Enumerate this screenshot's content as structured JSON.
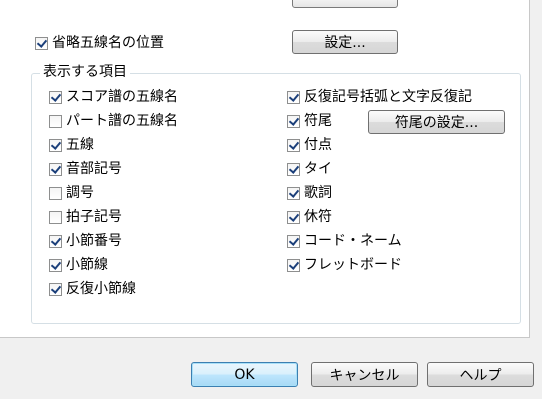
{
  "top_option": {
    "label": "省略五線名の位置",
    "checked": true,
    "button_label": "設定..."
  },
  "group": {
    "title": "表示する項目",
    "left_items": [
      {
        "label": "スコア譜の五線名",
        "checked": true
      },
      {
        "label": "パート譜の五線名",
        "checked": false
      },
      {
        "label": "五線",
        "checked": true
      },
      {
        "label": "音部記号",
        "checked": true
      },
      {
        "label": "調号",
        "checked": false
      },
      {
        "label": "拍子記号",
        "checked": false
      },
      {
        "label": "小節番号",
        "checked": true
      },
      {
        "label": "小節線",
        "checked": true
      },
      {
        "label": "反復小節線",
        "checked": true
      }
    ],
    "right_items": [
      {
        "label": "反復記号括弧と文字反復記",
        "checked": true
      },
      {
        "label": "符尾",
        "checked": true
      },
      {
        "label": "付点",
        "checked": true
      },
      {
        "label": "タイ",
        "checked": true
      },
      {
        "label": "歌詞",
        "checked": true
      },
      {
        "label": "休符",
        "checked": true
      },
      {
        "label": "コード・ネーム",
        "checked": true
      },
      {
        "label": "フレットボード",
        "checked": true
      }
    ],
    "stem_settings_button": "符尾の設定..."
  },
  "footer": {
    "ok_label": "OK",
    "cancel_label": "キャンセル",
    "help_label": "ヘルプ"
  }
}
